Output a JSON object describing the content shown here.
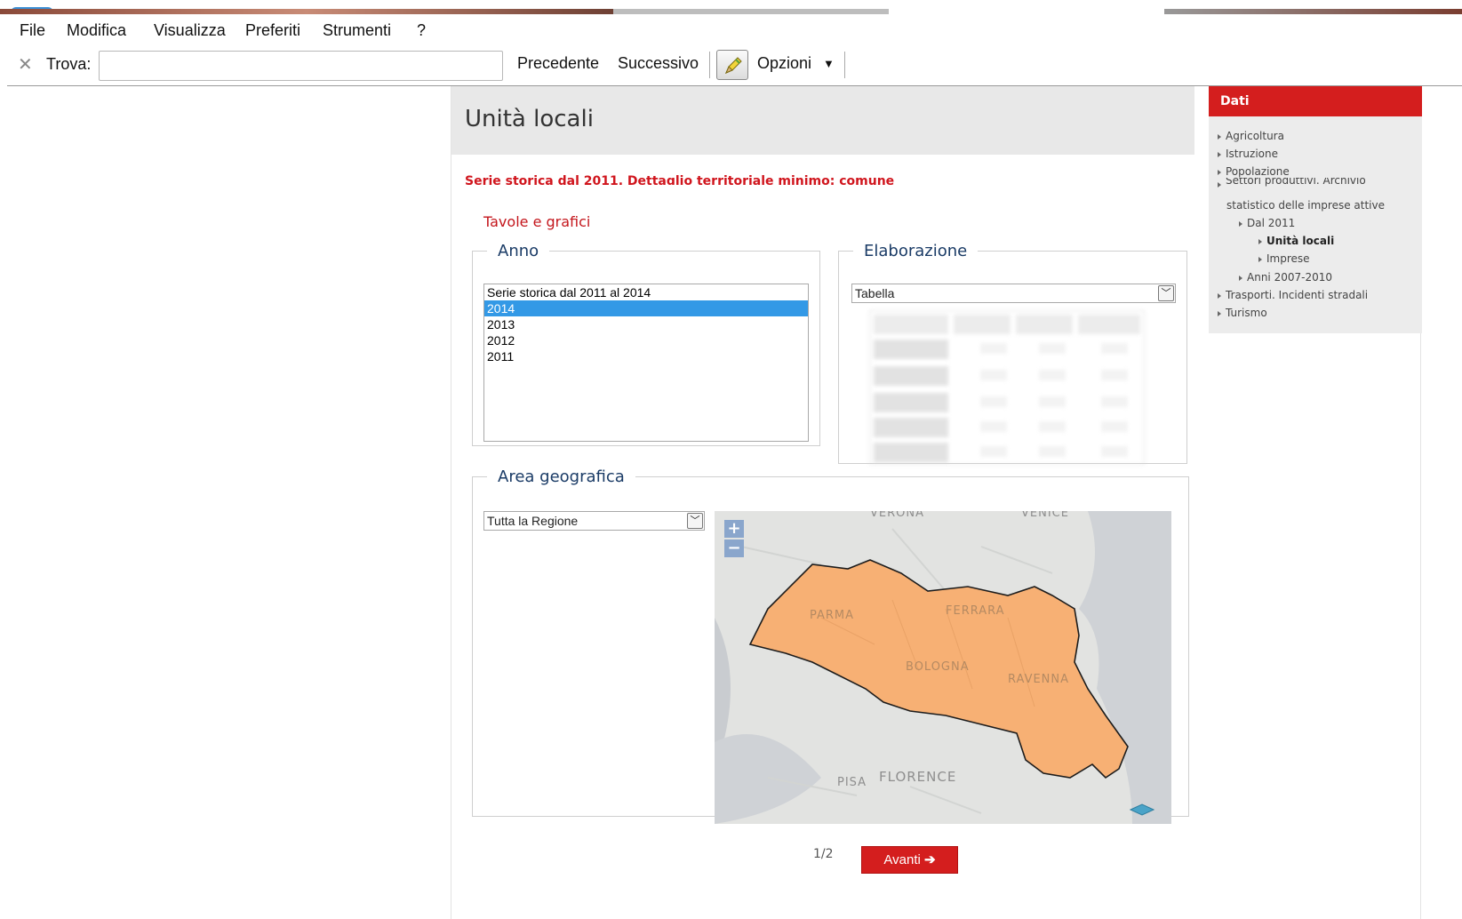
{
  "menu": [
    "File",
    "Modifica",
    "Visualizza",
    "Preferiti",
    "Strumenti",
    "?"
  ],
  "findbar": {
    "label": "Trova:",
    "value": "",
    "previous": "Precedente",
    "next": "Successivo",
    "options": "Opzioni"
  },
  "page": {
    "title": "Unità locali",
    "subtitle": "Serie storica dal 2011. Dettaglio territoriale minimo: comune",
    "section": "Tavole e grafici"
  },
  "anno": {
    "legend": "Anno",
    "options": [
      "Serie storica dal 2011 al 2014",
      "2014",
      "2013",
      "2012",
      "2011"
    ],
    "selected": "2014"
  },
  "elaborazione": {
    "legend": "Elaborazione",
    "selected": "Tabella"
  },
  "area": {
    "legend": "Area geografica",
    "selected": "Tutta la Regione",
    "map": {
      "zoom_in": "+",
      "zoom_out": "−",
      "cities": [
        "VERONA",
        "VENICE",
        "PARMA",
        "FERRARA",
        "BOLOGNA",
        "RAVENNA",
        "PISA",
        "FLORENCE"
      ]
    }
  },
  "pager": {
    "text": "1/2",
    "next_label": "Avanti"
  },
  "sidebar": {
    "title": "Dati",
    "items": [
      "Agricoltura",
      "Istruzione",
      "Popolazione",
      "Settori produttivi. Archivio",
      "statistico delle imprese attive",
      "Dal 2011",
      "Unità locali",
      "Imprese",
      "Anni 2007-2010",
      "Trasporti. Incidenti stradali",
      "Turismo"
    ]
  },
  "colors": {
    "accent_red": "#d41e1e",
    "legend_blue": "#1a3b66",
    "region_fill": "#f7b074",
    "selection_blue": "#3399e6"
  }
}
